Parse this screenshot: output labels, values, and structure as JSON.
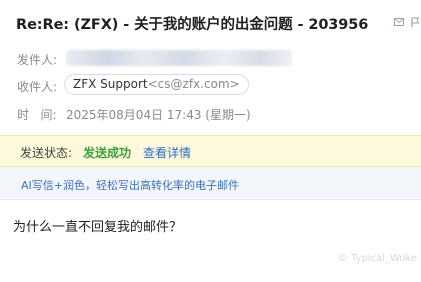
{
  "email": {
    "subject": "Re:Re: (ZFX) - 关于我的账户的出金问题 - 203956",
    "sender_label": "发件人:",
    "recipient_label": "收件人:",
    "recipient_name": "ZFX Support",
    "recipient_addr": "<cs@zfx.com>",
    "time_label": "时    间:",
    "time_value": "2025年08月04日 17:43 (星期一)"
  },
  "status": {
    "label": "发送状态:",
    "value": "发送成功",
    "link": "查看详情",
    "value_color": "#3aa13a"
  },
  "ai_banner": {
    "text": "AI写信+润色，轻松写出高转化率的电子邮件"
  },
  "body": {
    "text": "为什么一直不回复我的邮件？"
  },
  "watermark": {
    "text": "© Typical_Woke"
  },
  "icons": {
    "reply": "mail-reply-icon",
    "flag": "flag-icon"
  }
}
